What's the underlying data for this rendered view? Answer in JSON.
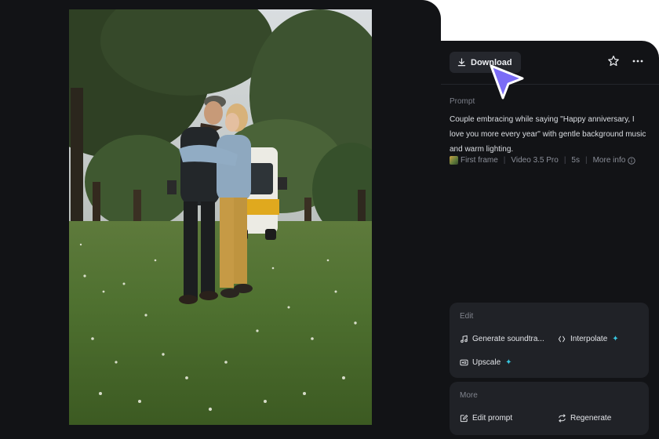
{
  "toolbar": {
    "download_label": "Download",
    "icons": [
      "download-icon",
      "star-icon",
      "more-icon"
    ]
  },
  "prompt": {
    "label": "Prompt",
    "text": "Couple embracing while saying \"Happy anniversary, I love you more every year\" with gentle background music and warm lighting."
  },
  "meta": {
    "first_frame": "First frame",
    "model": "Video 3.5 Pro",
    "duration": "5s",
    "more_info": "More info"
  },
  "edit": {
    "title": "Edit",
    "generate_soundtrack": "Generate soundtra...",
    "interpolate": "Interpolate",
    "upscale": "Upscale"
  },
  "more": {
    "title": "More",
    "edit_prompt": "Edit prompt",
    "regenerate": "Regenerate"
  },
  "colors": {
    "panel_bg": "#121316",
    "card_bg": "#202227",
    "accent_sparkle": "#37c6e0",
    "cursor": "#7b6cf6"
  }
}
